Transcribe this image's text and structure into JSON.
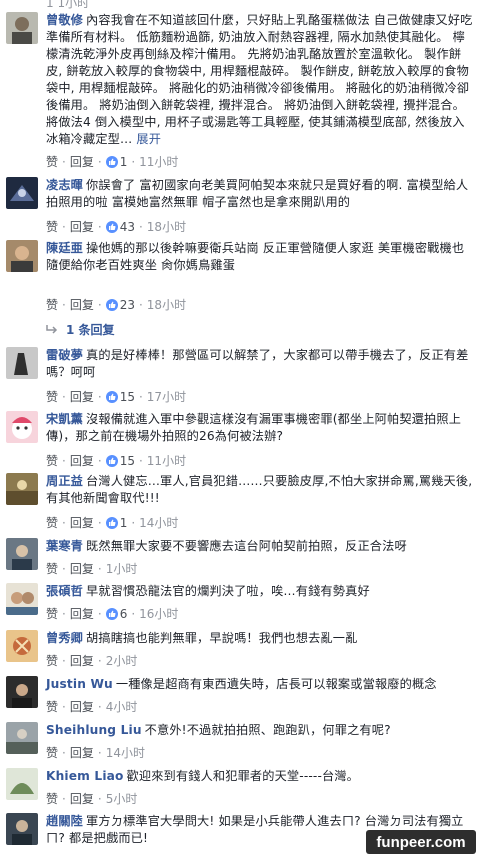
{
  "labels": {
    "like": "赞",
    "reply": "回复",
    "sep": "·"
  },
  "top_fragment": "1  1小时",
  "comments": [
    {
      "author": "曾敬修",
      "text": "內容我會在不知道該回什麼，只好貼上乳酪蛋糕做法 自己做健康又好吃 準備所有材料。 低筋麵粉過篩, 奶油放入耐熱容器裡, 隔水加熱使其融化。 檸檬清洗乾淨外皮再刨絲及榨汁備用。 先將奶油乳酪放置於室溫軟化。 製作餅皮, 餅乾放入較厚的食物袋中, 用桿麵棍敲碎。 製作餅皮, 餅乾放入較厚的食物袋中, 用桿麵棍敲碎。 將融化的奶油稍微冷卻後備用。 將融化的奶油稍微冷卻後備用。 將奶油倒入餅乾袋裡, 攪拌混合。 將奶油倒入餅乾袋裡, 攪拌混合。 將做法4 倒入模型中, 用杯子或湯匙等工具輕壓, 使其鋪滿模型底部, 然後放入冰箱冷藏定型…",
      "more": "展开",
      "likes": "1",
      "time": "11小时"
    },
    {
      "author": "凌志暉",
      "text": "你誤會了 富初國家向老美買阿帕契本來就只是買好看的啊. 富模型給人拍照用的啦 富模她富然無罪 帽子富然也是拿來開趴用的",
      "likes": "43",
      "time": "18小时"
    },
    {
      "author": "陳廷亜",
      "text": "操他媽的那以後幹嘛要衛兵站崗 反正軍營隨便人家逛 美軍機密戰機也隨便給你老百姓爽坐 肏你媽鳥雞蛋",
      "likes": "23",
      "time": "18小时",
      "replies": "1 条回复"
    },
    {
      "author": "雷破夢",
      "text": "真的是好棒棒！那營區可以解禁了，大家都可以帶手機去了，反正有差嗎？呵呵",
      "likes": "15",
      "time": "17小时"
    },
    {
      "author": "宋凱薰",
      "text": "沒報備就進入軍中參觀這樣沒有漏軍事機密罪(都坐上阿帕契還拍照上傳)，那之前在機場外拍照的26為何被法辦?",
      "likes": "15",
      "time": "11小时"
    },
    {
      "author": "周正益",
      "text": "台灣人健忘…軍人,官員犯錯……只要臉皮厚,不怕大家拼命罵,罵幾天後,有其他新聞會取代!!!",
      "likes": "1",
      "time": "14小时"
    },
    {
      "author": "葉寒青",
      "text": "既然無罪大家要不要響應去這台阿帕契前拍照，反正合法呀",
      "time": "1小时"
    },
    {
      "author": "張碩哲",
      "text": "早就習慣恐龍法官的爛判決了啦，唉…有錢有勢真好",
      "likes": "6",
      "time": "16小时"
    },
    {
      "author": "曾秀卿",
      "text": "胡搞瞎搞也能判無罪，早說嗎！我們也想去亂一亂",
      "time": "2小时"
    },
    {
      "author": "Justin Wu",
      "text": "一種像是超商有東西遺失時，店長可以報案或當報廢的概念",
      "time": "4小时"
    },
    {
      "author": "Sheihlung Liu",
      "text": "不意外!不過就拍拍照、跑跑趴，何罪之有呢?",
      "time": "14小时"
    },
    {
      "author": "Khiem Liao",
      "text": "歡迎來到有錢人和犯罪者的天堂-----台灣。",
      "time": "5小时"
    },
    {
      "author": "趙關陸",
      "text": "軍方ㄉ標準官大學問大! 如果是小兵能帶人進去ㄇ? 台灣ㄉ司法有獨立ㄇ? 都是把戲而已!"
    }
  ],
  "watermark": "funpeer.com",
  "colors": {
    "link": "#365899",
    "meta": "#90949c",
    "like_icon": "#5890ff"
  },
  "icons": [
    "thumbs-up-icon",
    "reply-arrow-icon",
    "avatar"
  ]
}
